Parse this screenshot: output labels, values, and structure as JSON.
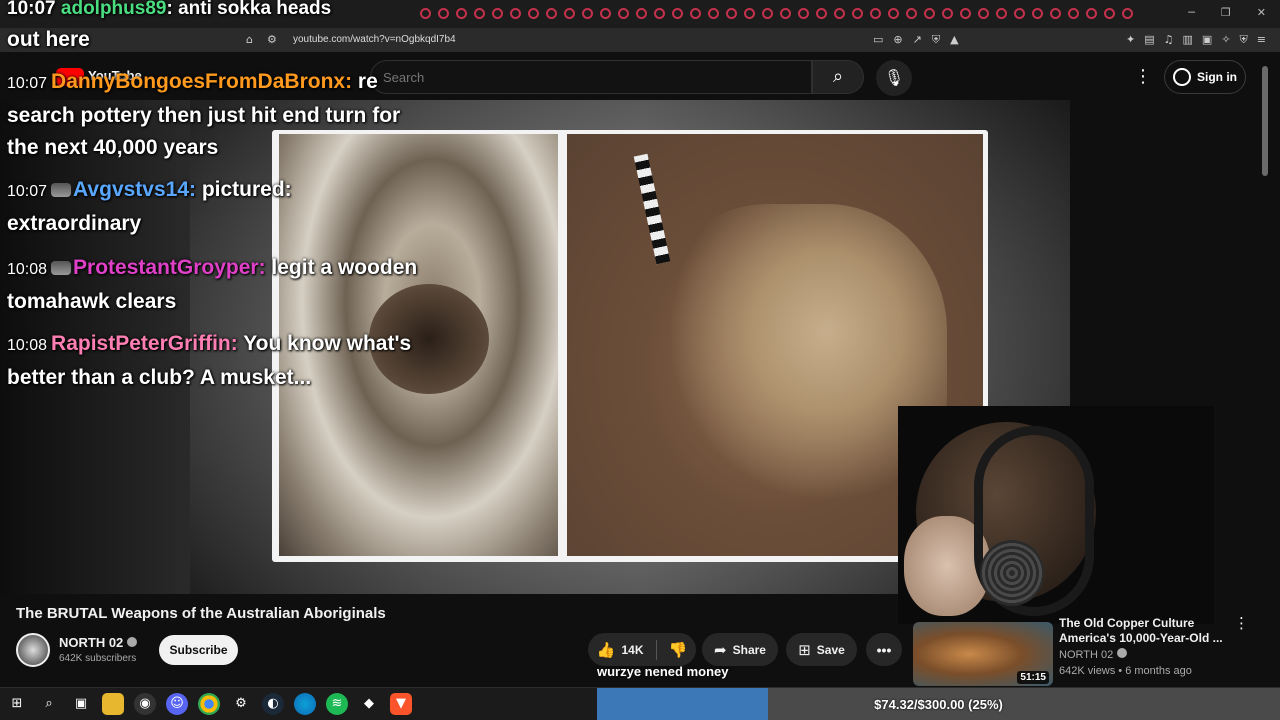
{
  "browser": {
    "url": "youtube.com/watch?v=nOgbkqdI7b4"
  },
  "youtube": {
    "logo_text": "YouTube",
    "search_placeholder": "Search",
    "signin_label": "Sign in"
  },
  "chat": {
    "top_time": "10:07",
    "top_user": "adolphus89",
    "top_text": "anti sokka heads",
    "top_line2": "out here",
    "messages": [
      {
        "time": "10:07",
        "user": "DannyBongoesFromDaBronx",
        "text": "re search pottery then just hit end turn for the next 40,000 years",
        "color": "#ff9a1f"
      },
      {
        "time": "10:07",
        "user": "Avgvstvs14",
        "text": "pictured: extraordinary",
        "color": "#5aa7ff"
      },
      {
        "time": "10:08",
        "user": "ProtestantGroyper",
        "text": "legit a wooden tomahawk clears",
        "color": "#e040c8"
      },
      {
        "time": "10:08",
        "user": "RapistPeterGriffin",
        "text": "You know what's better than a club? A musket...",
        "color": "#ff7eb3"
      }
    ]
  },
  "video": {
    "title": "The BRUTAL Weapons of the Australian Aboriginals",
    "channel": "NORTH 02",
    "subscribers": "642K subscribers",
    "subscribe_label": "Subscribe",
    "likes": "14K",
    "share_label": "Share",
    "save_label": "Save"
  },
  "overlay": {
    "tts_text": "wurzye nened money"
  },
  "recommended": {
    "title": "The Old Copper Culture America's 10,000-Year-Old ...",
    "channel": "NORTH 02",
    "meta": "642K views • 6 months ago",
    "duration": "51:15"
  },
  "donation_goal": {
    "text": "$74.32/$300.00 (25%)",
    "fraction": 0.25
  },
  "icons": {
    "like": "thumbs-up-icon",
    "dislike": "thumbs-down-icon",
    "share": "share-icon",
    "save": "bookmark-icon"
  }
}
